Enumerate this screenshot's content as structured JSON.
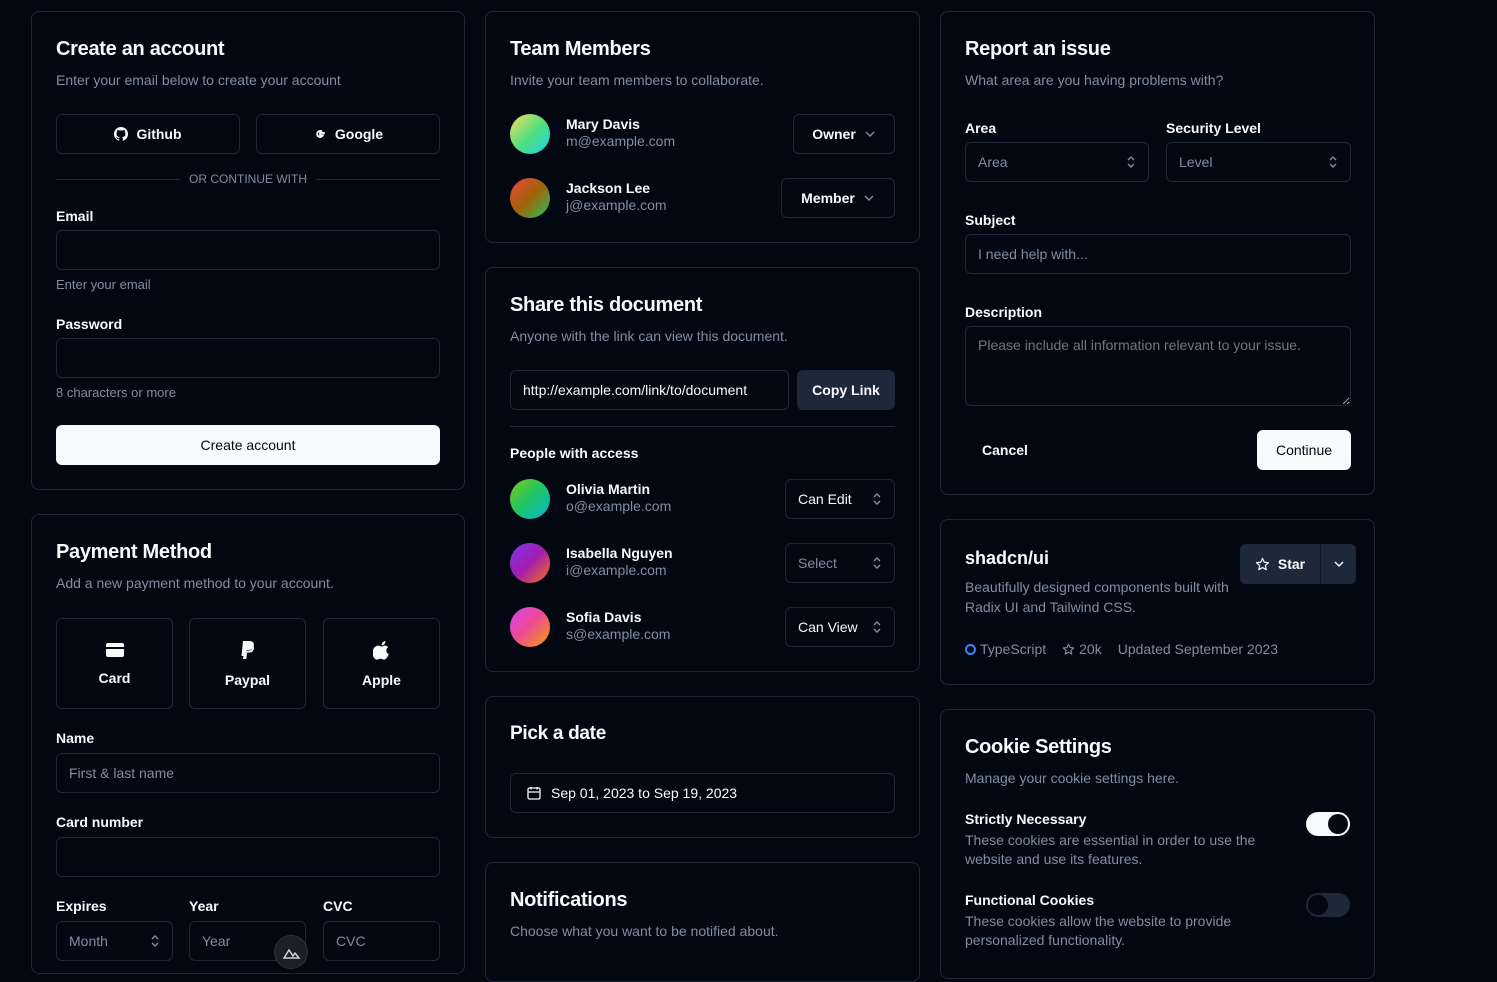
{
  "create_account": {
    "title": "Create an account",
    "subtitle": "Enter your email below to create your account",
    "github_label": "Github",
    "google_label": "Google",
    "or_continue": "OR CONTINUE WITH",
    "email_label": "Email",
    "email_hint": "Enter your email",
    "email_value": "",
    "password_label": "Password",
    "password_hint": "8 characters or more",
    "password_value": "",
    "submit_label": "Create account"
  },
  "payment": {
    "title": "Payment Method",
    "subtitle": "Add a new payment method to your account.",
    "methods": [
      {
        "label": "Card",
        "icon": "credit-card-icon"
      },
      {
        "label": "Paypal",
        "icon": "paypal-icon"
      },
      {
        "label": "Apple",
        "icon": "apple-icon"
      }
    ],
    "name_label": "Name",
    "name_placeholder": "First & last name",
    "card_number_label": "Card number",
    "expires_label": "Expires",
    "month_placeholder": "Month",
    "year_label": "Year",
    "year_placeholder": "Year",
    "cvc_label": "CVC",
    "cvc_placeholder": "CVC"
  },
  "team": {
    "title": "Team Members",
    "subtitle": "Invite your team members to collaborate.",
    "members": [
      {
        "name": "Mary Davis",
        "email": "m@example.com",
        "role": "Owner"
      },
      {
        "name": "Jackson Lee",
        "email": "j@example.com",
        "role": "Member"
      }
    ]
  },
  "share": {
    "title": "Share this document",
    "subtitle": "Anyone with the link can view this document.",
    "link": "http://example.com/link/to/document",
    "copy_label": "Copy Link",
    "people_label": "People with access",
    "people": [
      {
        "name": "Olivia Martin",
        "email": "o@example.com",
        "permission": "Can Edit",
        "placeholder": false
      },
      {
        "name": "Isabella Nguyen",
        "email": "i@example.com",
        "permission": "Select",
        "placeholder": true
      },
      {
        "name": "Sofia Davis",
        "email": "s@example.com",
        "permission": "Can View",
        "placeholder": false
      }
    ]
  },
  "date": {
    "title": "Pick a date",
    "range": "Sep 01, 2023 to Sep 19, 2023"
  },
  "notifications": {
    "title": "Notifications",
    "subtitle": "Choose what you want to be notified about."
  },
  "report": {
    "title": "Report an issue",
    "subtitle": "What area are you having problems with?",
    "area_label": "Area",
    "area_placeholder": "Area",
    "security_label": "Security Level",
    "security_placeholder": "Level",
    "subject_label": "Subject",
    "subject_placeholder": "I need help with...",
    "description_label": "Description",
    "description_placeholder": "Please include all information relevant to your issue.",
    "cancel_label": "Cancel",
    "continue_label": "Continue"
  },
  "repo": {
    "name": "shadcn/ui",
    "description": "Beautifully designed components built with Radix UI and Tailwind CSS.",
    "star_label": "Star",
    "language": "TypeScript",
    "stars": "20k",
    "updated": "Updated September 2023"
  },
  "cookies": {
    "title": "Cookie Settings",
    "subtitle": "Manage your cookie settings here.",
    "items": [
      {
        "title": "Strictly Necessary",
        "description": "These cookies are essential in order to use the website and use its features.",
        "enabled": true
      },
      {
        "title": "Functional Cookies",
        "description": "These cookies allow the website to provide personalized functionality.",
        "enabled": false
      }
    ]
  },
  "colors": {
    "background": "#030711",
    "border": "#1d283a",
    "muted_text": "#7f8ea3",
    "foreground": "#f8fafc",
    "typescript_dot": "#3b82f6"
  }
}
